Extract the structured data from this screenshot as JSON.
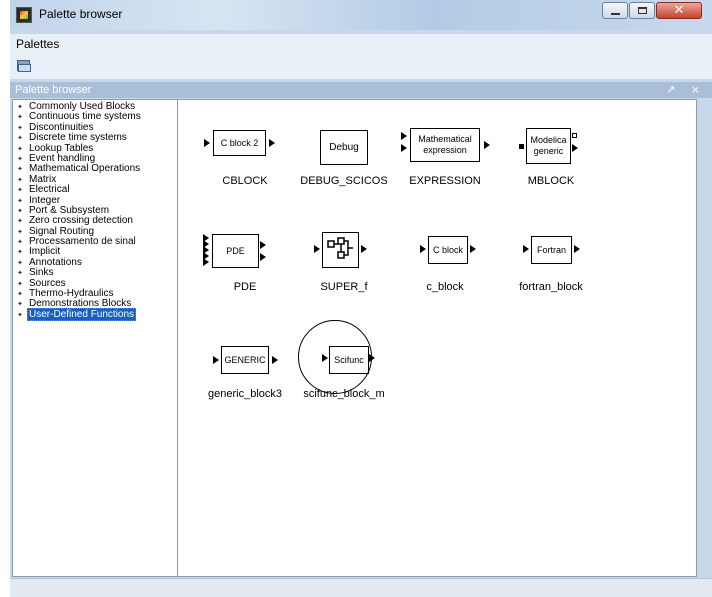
{
  "window": {
    "title": "Palette browser"
  },
  "menubar": {
    "palettes_label": "Palettes"
  },
  "panel": {
    "title": "Palette browser",
    "controls": "↗ ×"
  },
  "tree": {
    "items": [
      "Commonly Used Blocks",
      "Continuous time systems",
      "Discontinuities",
      "Discrete time systems",
      "Lookup Tables",
      "Event handling",
      "Mathematical Operations",
      "Matrix",
      "Electrical",
      "Integer",
      "Port & Subsystem",
      "Zero crossing detection",
      "Signal Routing",
      "Processamento de sinal",
      "Implicit",
      "Annotations",
      "Sinks",
      "Sources",
      "Thermo-Hydraulics",
      "Demonstrations Blocks",
      "User-Defined Functions"
    ],
    "selected": "User-Defined Functions"
  },
  "blocks": [
    {
      "box_text": "C block 2",
      "label": "CBLOCK"
    },
    {
      "box_text": "Debug",
      "label": "DEBUG_SCICOS"
    },
    {
      "box_text_line1": "Mathematical",
      "box_text_line2": "expression",
      "label": "EXPRESSION"
    },
    {
      "box_text_line1": "Modelica",
      "box_text_line2": "generic",
      "label": "MBLOCK"
    },
    {
      "box_text": "PDE",
      "label": "PDE"
    },
    {
      "box_text": "",
      "label": "SUPER_f"
    },
    {
      "box_text": "C block",
      "label": "c_block"
    },
    {
      "box_text": "Fortran",
      "label": "fortran_block"
    },
    {
      "box_text": "GENERIC",
      "label": "generic_block3"
    },
    {
      "box_text": "Scifunc",
      "label": "scifunc_block_m"
    }
  ],
  "icons": {
    "app": "scilab-app-icon",
    "open": "folder-open-icon",
    "bullet": "✦"
  }
}
